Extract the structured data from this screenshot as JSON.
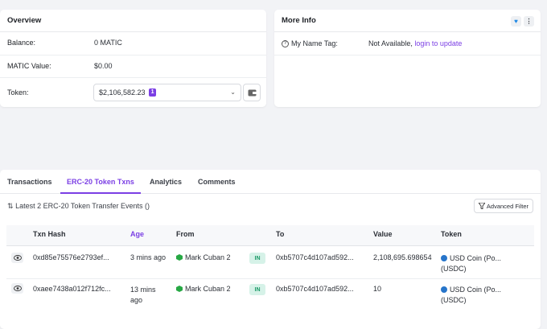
{
  "overview": {
    "title": "Overview",
    "balance_label": "Balance:",
    "balance_value": "0 MATIC",
    "matic_value_label": "MATIC Value:",
    "matic_value_value": "$0.00",
    "token_label": "Token:",
    "token_value": "$2,106,582.23",
    "token_count": "1"
  },
  "more_info": {
    "title": "More Info",
    "name_tag_label": "My Name Tag:",
    "name_tag_value": "Not Available, ",
    "name_tag_link": "login to update"
  },
  "tabs": [
    {
      "label": "Transactions"
    },
    {
      "label": "ERC-20 Token Txns"
    },
    {
      "label": "Analytics"
    },
    {
      "label": "Comments"
    }
  ],
  "active_tab": "ERC-20 Token Txns",
  "summary": "Latest 2 ERC-20 Token Transfer Events ()",
  "advanced_filter": "Advanced Filter",
  "columns": [
    "Txn Hash",
    "Age",
    "From",
    "",
    "To",
    "Value",
    "Token"
  ],
  "rows": [
    {
      "hash": "0xd85e75576e2793ef...",
      "age": "3 mins ago",
      "age_line2": "",
      "from": "Mark Cuban 2",
      "direction": "IN",
      "to": "0xb5707c4d107ad592...",
      "value": "2,108,695.698654",
      "token": "USD Coin (Po...",
      "token_symbol": "(USDC)"
    },
    {
      "hash": "0xaee7438a012f712fc...",
      "age": "13 mins",
      "age_line2": "ago",
      "from": "Mark Cuban 2",
      "direction": "IN",
      "to": "0xb5707c4d107ad592...",
      "value": "10",
      "token": "USD Coin (Po...",
      "token_symbol": "(USDC)"
    }
  ],
  "colors": {
    "accent": "#7b3fe4",
    "in_badge": "#1a9966",
    "usdc": "#2775ca"
  }
}
